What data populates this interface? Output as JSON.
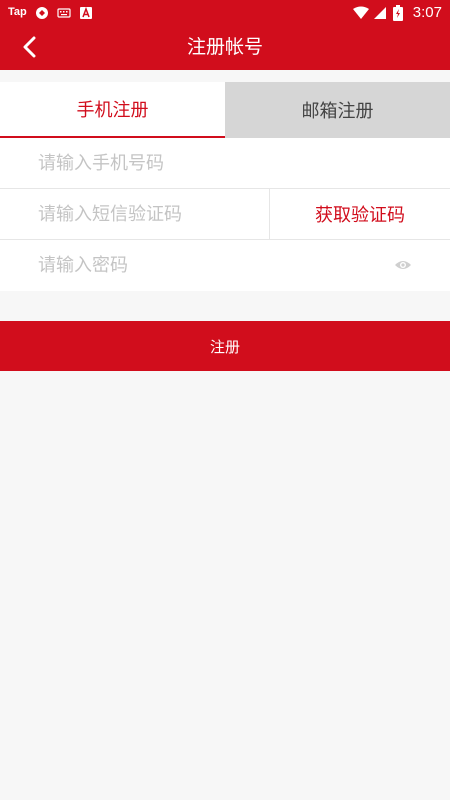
{
  "status_bar": {
    "left_label": "Tap",
    "time": "3:07"
  },
  "header": {
    "title": "注册帐号"
  },
  "tabs": [
    {
      "label": "手机注册"
    },
    {
      "label": "邮箱注册"
    }
  ],
  "form": {
    "phone_placeholder": "请输入手机号码",
    "code_placeholder": "请输入短信验证码",
    "get_code_label": "获取验证码",
    "password_placeholder": "请输入密码"
  },
  "register_label": "注册",
  "colors": {
    "brand": "#d10d1c",
    "inactive_tab": "#d6d6d6"
  }
}
